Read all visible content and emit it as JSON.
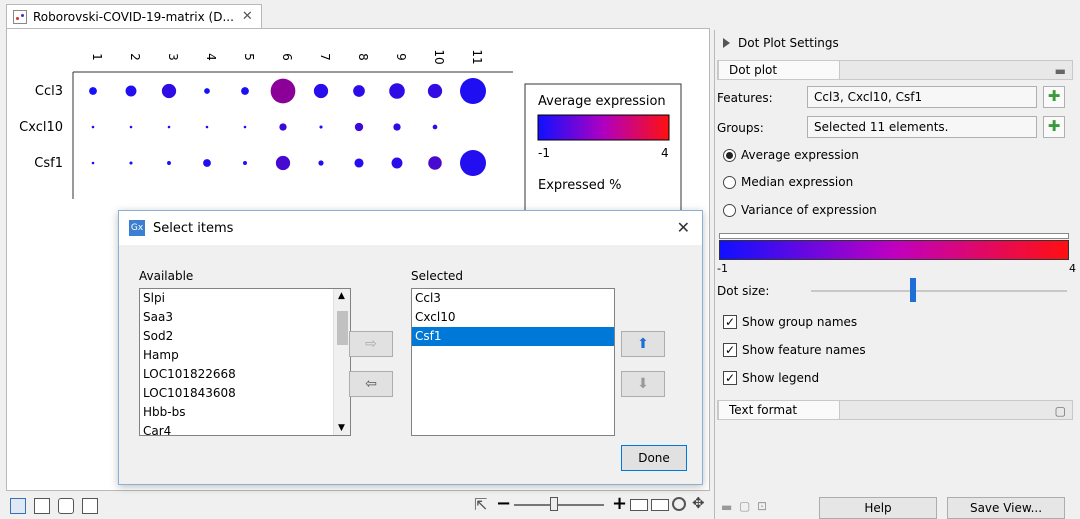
{
  "tab": {
    "title": "Roborovski-COVID-19-matrix (D...",
    "close": "✕"
  },
  "plot": {
    "columns": [
      "1",
      "2",
      "3",
      "4",
      "5",
      "6",
      "7",
      "8",
      "9",
      "10",
      "11"
    ],
    "rows": [
      "Ccl3",
      "Cxcl10",
      "Csf1"
    ],
    "dots": [
      [
        [
          0.3,
          0.05
        ],
        [
          0.42,
          0.15
        ],
        [
          0.55,
          0.25
        ],
        [
          0.22,
          0.05
        ],
        [
          0.3,
          0.1
        ],
        [
          0.95,
          0.98
        ],
        [
          0.55,
          0.2
        ],
        [
          0.45,
          0.22
        ],
        [
          0.6,
          0.25
        ],
        [
          0.55,
          0.28
        ],
        [
          1.0,
          0.12
        ]
      ],
      [
        [
          0.1,
          0.1
        ],
        [
          0.1,
          0.1
        ],
        [
          0.1,
          0.1
        ],
        [
          0.1,
          0.1
        ],
        [
          0.1,
          0.1
        ],
        [
          0.28,
          0.35
        ],
        [
          0.12,
          0.1
        ],
        [
          0.32,
          0.35
        ],
        [
          0.28,
          0.25
        ],
        [
          0.18,
          0.25
        ],
        [
          0,
          0
        ]
      ],
      [
        [
          0.1,
          0.1
        ],
        [
          0.12,
          0.1
        ],
        [
          0.15,
          0.1
        ],
        [
          0.3,
          0.15
        ],
        [
          0.15,
          0.1
        ],
        [
          0.55,
          0.45
        ],
        [
          0.2,
          0.1
        ],
        [
          0.35,
          0.15
        ],
        [
          0.42,
          0.2
        ],
        [
          0.52,
          0.45
        ],
        [
          1.0,
          0.15
        ]
      ]
    ],
    "legend": {
      "title": "Average expression",
      "min": "-1",
      "max": "4",
      "expressed": "Expressed %"
    }
  },
  "colors": {
    "low": "#1010ff",
    "mid": "#9000a0",
    "high": "#ff1010",
    "accent": "#0078d7"
  },
  "right_panel": {
    "title": "Dot Plot Settings",
    "dot_plot_tab": "Dot plot",
    "features_label": "Features:",
    "features_value": "Ccl3, Cxcl10, Csf1",
    "groups_label": "Groups:",
    "groups_value": "Selected 11 elements.",
    "radio_average": "Average expression",
    "radio_median": "Median expression",
    "radio_variance": "Variance of expression",
    "gradient_min": "-1",
    "gradient_max": "4",
    "dot_size_label": "Dot size:",
    "dot_size_level": 0.4,
    "check_group_names": "Show group names",
    "check_feature_names": "Show feature names",
    "check_legend": "Show legend",
    "text_format_tab": "Text format",
    "help_button": "Help",
    "save_view_button": "Save View..."
  },
  "dialog": {
    "title": "Select items",
    "available_label": "Available",
    "available_items": [
      "Slpi",
      "Saa3",
      "Sod2",
      "Hamp",
      "LOC101822668",
      "LOC101843608",
      "Hbb-bs",
      "Car4"
    ],
    "selected_label": "Selected",
    "selected_items": [
      "Ccl3",
      "Cxcl10",
      "Csf1"
    ],
    "selected_highlight": "Csf1",
    "done_button": "Done"
  }
}
